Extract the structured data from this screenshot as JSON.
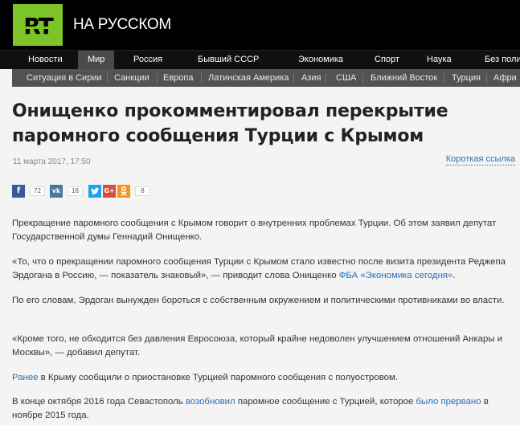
{
  "header": {
    "logo": "RT",
    "site_name": "НА РУССКОМ"
  },
  "nav": {
    "items": [
      "Новости",
      "Мир",
      "Россия",
      "Бывший СССР",
      "Экономика",
      "Спорт",
      "Наука",
      "Без полит"
    ],
    "active": "Мир"
  },
  "subnav": {
    "items": [
      "Ситуация в Сирии",
      "Санкции",
      "Европа",
      "Латинская Америка",
      "Азия",
      "США",
      "Ближний Восток",
      "Турция",
      "Афри"
    ]
  },
  "article": {
    "title": "Онищенко прокомментировал перекрытие паромного сообщения Турции с Крымом",
    "date": "11 марта 2017, 17:50",
    "short_link": "Короткая ссылка",
    "share": {
      "facebook_count": "72",
      "vk_count": "16",
      "ok_count": "8"
    },
    "p1": "Прекращение паромного сообщения с Крымом говорит о внутренних проблемах Турции. Об этом заявил депутат Государственной думы Геннадий Онищенко.",
    "p2_text": "«То, что о прекращении паромного сообщения Турции с Крымом стало известно после визита президента Реджепа Эрдогана в Россию, — показатель знаковый», — приводит слова Онищенко ",
    "p2_link": "ФБА «Экономика сегодня»",
    "p2_end": ".",
    "p3": "По его словам, Эрдоган вынужден бороться с собственным окружением и политическими противниками во власти.",
    "p4": "«Кроме того, не обходится без давления Евросоюза, который крайне недоволен улучшением отношений Анкары и Москвы», — добавил депутат.",
    "p5_link": "Ранее",
    "p5_text": " в Крыму сообщили о приостановке Турцией паромного сообщения с полуостровом.",
    "p6_a": "В конце октября 2016 года Севастополь ",
    "p6_link1": "возобновил",
    "p6_b": " паромное сообщение с Турцией, которое ",
    "p6_link2": "было прервано",
    "p6_c": " в ноябре 2015 года."
  },
  "colors": {
    "brand": "#7cc428",
    "link": "#2b6fb5",
    "facebook": "#3b5998",
    "vk": "#4c75a3",
    "twitter": "#1da1f2",
    "googleplus": "#dd4b39",
    "odnoklassniki": "#f7931e"
  }
}
